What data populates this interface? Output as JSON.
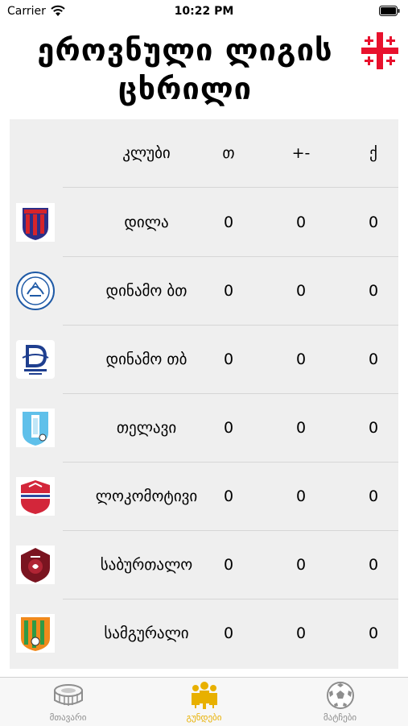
{
  "status_bar": {
    "carrier": "Carrier",
    "time": "10:22 PM"
  },
  "header": {
    "title_line1": "ეროვნული ლიგის",
    "title_line2": "ცხრილი",
    "flag_icon": "georgia-flag-icon"
  },
  "table": {
    "columns": [
      "კლუბი",
      "თ",
      "+-",
      "ქ"
    ],
    "rows": [
      {
        "club": "დილა",
        "played": "0",
        "goal_diff": "0",
        "points": "0",
        "logo": "dila-logo"
      },
      {
        "club": "დინამო ბთ",
        "played": "0",
        "goal_diff": "0",
        "points": "0",
        "logo": "dinamo-batumi-logo"
      },
      {
        "club": "დინამო თბ",
        "played": "0",
        "goal_diff": "0",
        "points": "0",
        "logo": "dinamo-tbilisi-logo"
      },
      {
        "club": "თელავი",
        "played": "0",
        "goal_diff": "0",
        "points": "0",
        "logo": "telavi-logo"
      },
      {
        "club": "ლოკომოტივი",
        "played": "0",
        "goal_diff": "0",
        "points": "0",
        "logo": "lokomotivi-logo"
      },
      {
        "club": "საბურთალო",
        "played": "0",
        "goal_diff": "0",
        "points": "0",
        "logo": "saburtalo-logo"
      },
      {
        "club": "სამგურალი",
        "played": "0",
        "goal_diff": "0",
        "points": "0",
        "logo": "samgurali-logo"
      }
    ]
  },
  "tabs": [
    {
      "label": "მთავარი",
      "icon": "stadium-icon"
    },
    {
      "label": "გუნდები",
      "icon": "teams-icon",
      "active": true
    },
    {
      "label": "მატჩები",
      "icon": "soccer-ball-icon"
    }
  ],
  "colors": {
    "accent": "#e8b000",
    "table_bg": "#efefef",
    "flag_red": "#e8112d"
  }
}
